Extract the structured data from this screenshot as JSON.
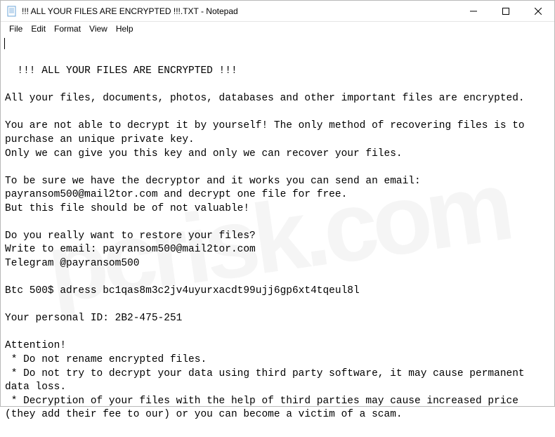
{
  "titlebar": {
    "title": "!!! ALL YOUR FILES ARE ENCRYPTED !!!.TXT - Notepad"
  },
  "menubar": {
    "items": [
      "File",
      "Edit",
      "Format",
      "View",
      "Help"
    ]
  },
  "content": {
    "text": "!!! ALL YOUR FILES ARE ENCRYPTED !!!\n\nAll your files, documents, photos, databases and other important files are encrypted.\n\nYou are not able to decrypt it by yourself! The only method of recovering files is to purchase an unique private key.\nOnly we can give you this key and only we can recover your files.\n\nTo be sure we have the decryptor and it works you can send an email: payransom500@mail2tor.com and decrypt one file for free.\nBut this file should be of not valuable!\n\nDo you really want to restore your files?\nWrite to email: payransom500@mail2tor.com\nTelegram @payransom500\n\nBtc 500$ adress bc1qas8m3c2jv4uyurxacdt99ujj6gp6xt4tqeul8l\n\nYour personal ID: 2B2-475-251\n\nAttention!\n * Do not rename encrypted files.\n * Do not try to decrypt your data using third party software, it may cause permanent data loss.\n * Decryption of your files with the help of third parties may cause increased price (they add their fee to our) or you can become a victim of a scam."
  }
}
